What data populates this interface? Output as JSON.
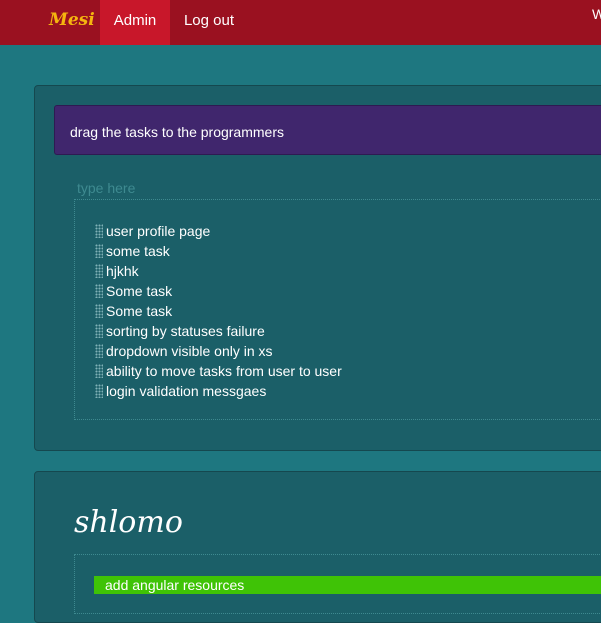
{
  "navbar": {
    "brand": "Mesi",
    "items": [
      {
        "label": "Admin"
      },
      {
        "label": "Log out"
      }
    ],
    "user_greeting_partial": "W"
  },
  "tasks_panel": {
    "instruction": "drag the tasks to the programmers",
    "search_placeholder": "type here",
    "tasks": [
      {
        "label": "user profile page"
      },
      {
        "label": "some task"
      },
      {
        "label": "hjkhk"
      },
      {
        "label": "Some task"
      },
      {
        "label": "Some task"
      },
      {
        "label": "sorting by statuses failure"
      },
      {
        "label": "dropdown visible only in xs"
      },
      {
        "label": "ability to move tasks from user to user"
      },
      {
        "label": "login validation messgaes"
      }
    ]
  },
  "programmer_panel": {
    "name": "shlomo",
    "tasks": [
      {
        "label": "add angular resources",
        "status_color": "#3fc306"
      }
    ]
  },
  "colors": {
    "navbar": "#9a1120",
    "nav_active": "#c8172a",
    "brand": "#f5b50f",
    "page_bg": "#1e7780",
    "panel_bg": "#1b5f68",
    "instruction_bg": "#40266d",
    "task_done": "#3fc306"
  }
}
